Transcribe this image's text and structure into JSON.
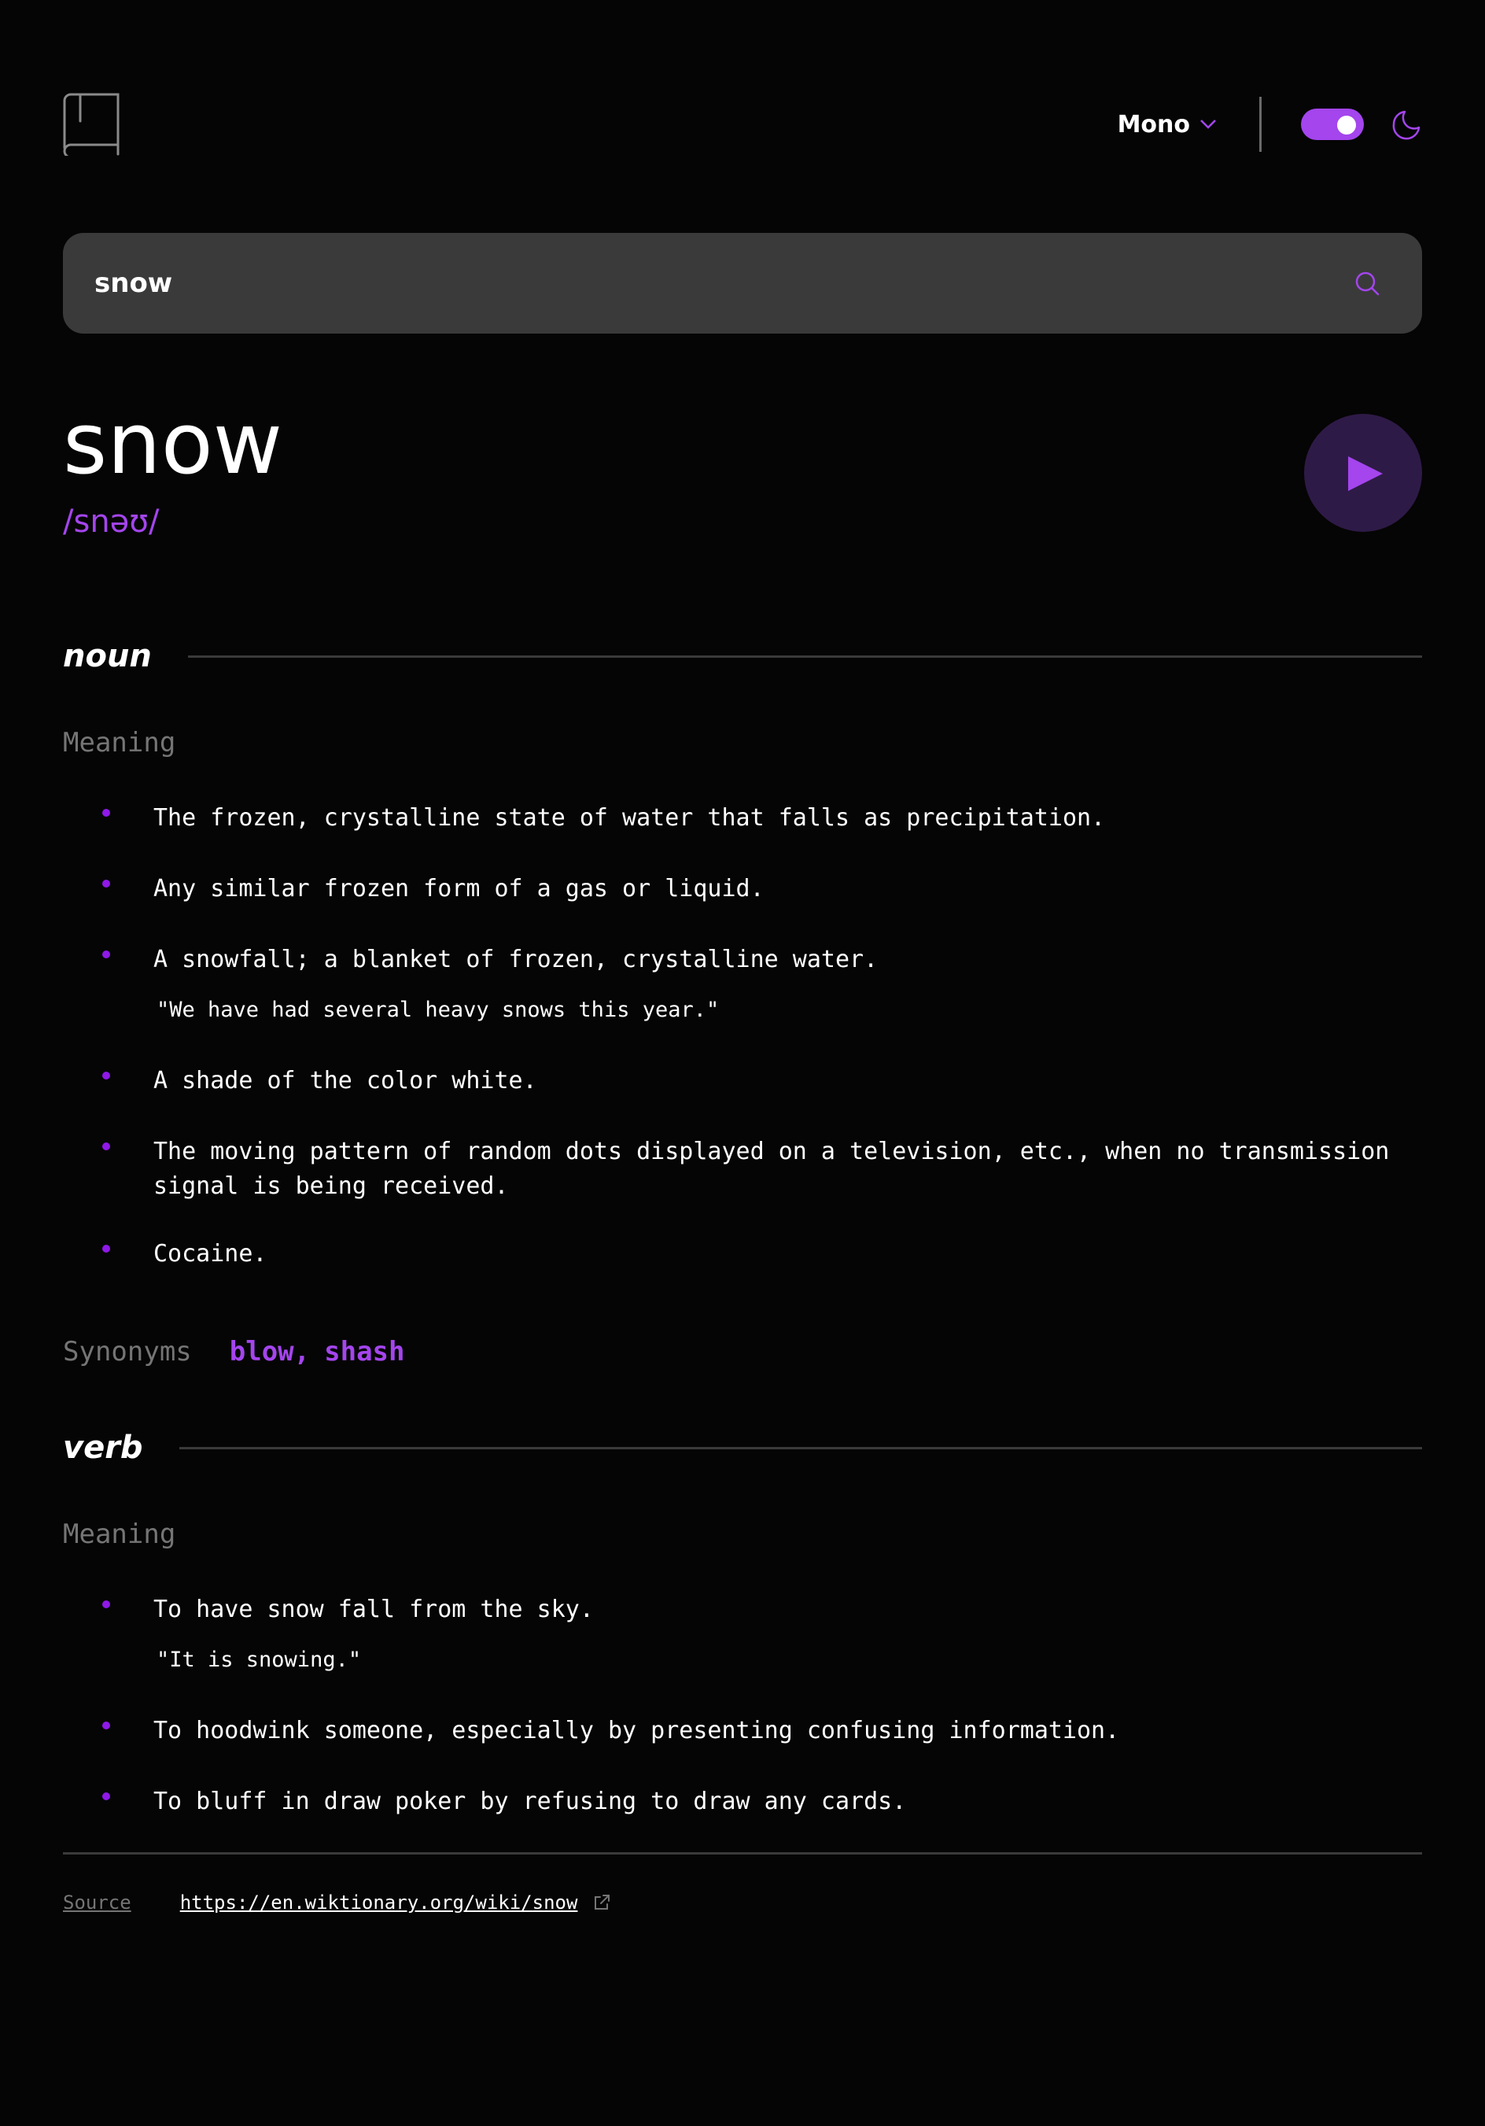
{
  "header": {
    "logo_icon": "book-icon",
    "font_selector": {
      "value": "Mono",
      "icon": "chevron-down-icon"
    },
    "theme_toggle": {
      "state": "dark",
      "icon": "moon-icon"
    }
  },
  "search": {
    "value": "snow",
    "icon": "search-icon"
  },
  "word": {
    "text": "snow",
    "phonetic": "/snəʊ/",
    "play_icon": "play-icon"
  },
  "meanings": [
    {
      "part_of_speech": "noun",
      "heading": "Meaning",
      "definitions": [
        {
          "text": "The frozen, crystalline state of water that falls as precipitation."
        },
        {
          "text": "Any similar frozen form of a gas or liquid."
        },
        {
          "text": "A snowfall; a blanket of frozen, crystalline water.",
          "example": "\"We have had several heavy snows this year.\""
        },
        {
          "text": "A shade of the color white."
        },
        {
          "text": "The moving pattern of random dots displayed on a television, etc., when no transmission signal is being received."
        },
        {
          "text": "Cocaine."
        }
      ],
      "synonyms_label": "Synonyms",
      "synonyms": [
        "blow",
        "shash"
      ]
    },
    {
      "part_of_speech": "verb",
      "heading": "Meaning",
      "definitions": [
        {
          "text": "To have snow fall from the sky.",
          "example": "\"It is snowing.\""
        },
        {
          "text": "To hoodwink someone, especially by presenting confusing information."
        },
        {
          "text": "To bluff in draw poker by refusing to draw any cards."
        }
      ]
    }
  ],
  "source": {
    "label": "Source",
    "url": "https://en.wiktionary.org/wiki/snow",
    "icon": "external-link-icon"
  },
  "colors": {
    "accent": "#a445ed",
    "bullet": "#8f19e8",
    "background": "#050505",
    "muted": "#757575",
    "input_bg": "#3a3a3a"
  }
}
